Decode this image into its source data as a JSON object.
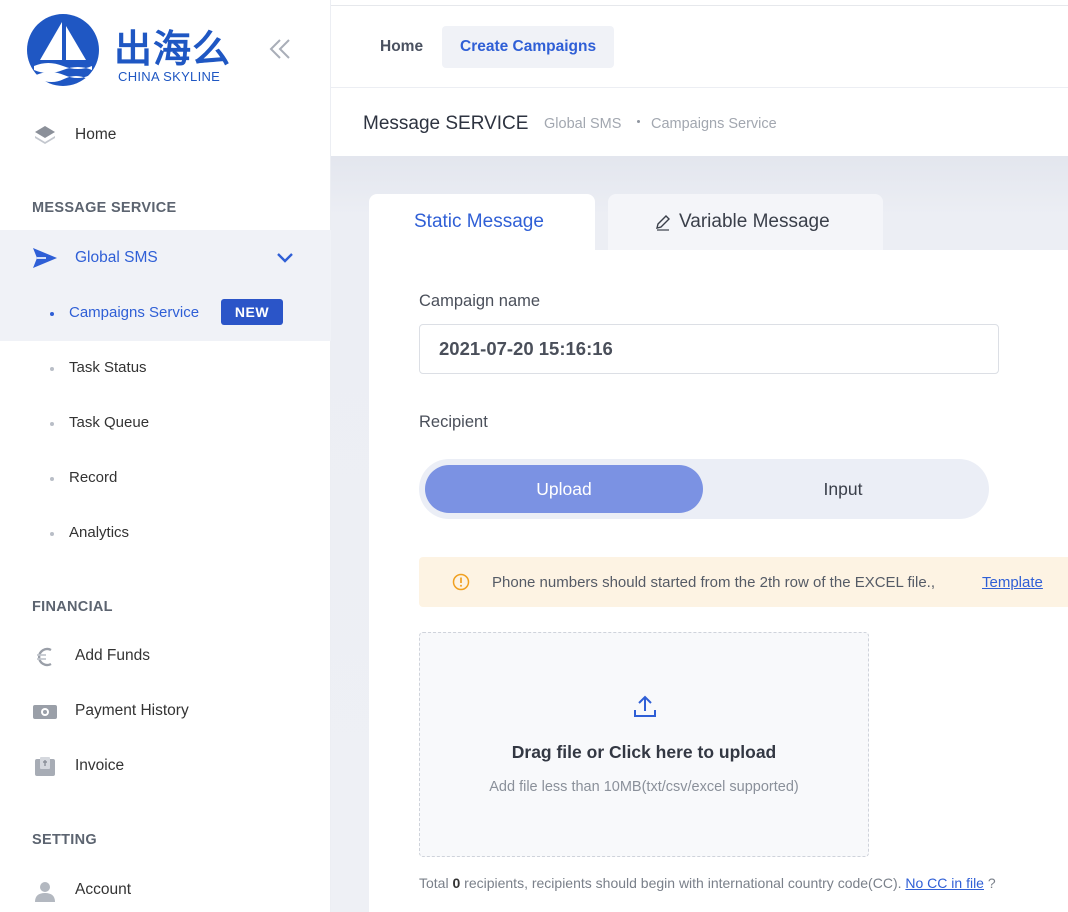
{
  "brand": {
    "name_cn": "出海么",
    "name_en": "CHINA SKYLINE",
    "primary_color": "#2f5fd6"
  },
  "sidebar": {
    "home_label": "Home",
    "sections": {
      "message_service": "MESSAGE SERVICE",
      "financial": "FINANCIAL",
      "setting": "SETTING"
    },
    "global_sms": {
      "label": "Global SMS",
      "expanded": true,
      "items": [
        {
          "label": "Campaigns Service",
          "badge": "NEW",
          "active": true
        },
        {
          "label": "Task Status"
        },
        {
          "label": "Task Queue"
        },
        {
          "label": "Record"
        },
        {
          "label": "Analytics"
        }
      ]
    },
    "financial_items": [
      {
        "label": "Add Funds",
        "icon": "euro-icon"
      },
      {
        "label": "Payment History",
        "icon": "money-icon"
      },
      {
        "label": "Invoice",
        "icon": "invoice-icon"
      }
    ],
    "setting_items": [
      {
        "label": "Account",
        "icon": "user-icon"
      }
    ]
  },
  "topbar": {
    "tabs": [
      {
        "label": "Home",
        "active": false
      },
      {
        "label": "Create Campaigns",
        "active": true
      }
    ]
  },
  "breadcrumb": {
    "title": "Message SERVICE",
    "path": [
      "Global SMS",
      "Campaigns Service"
    ]
  },
  "message_tabs": [
    {
      "label": "Static Message",
      "active": true
    },
    {
      "label": "Variable Message",
      "icon": "pen-icon",
      "active": false
    }
  ],
  "form": {
    "campaign_name_label": "Campaign name",
    "campaign_name_value": "2021-07-20 15:16:16",
    "recipient_label": "Recipient",
    "recipient_modes": [
      {
        "label": "Upload",
        "selected": true
      },
      {
        "label": "Input",
        "selected": false
      }
    ],
    "notice": {
      "text": "Phone numbers should started from the 2th row of the EXCEL file.,",
      "link": "Template",
      "color": "#fdf3e3"
    },
    "dropzone": {
      "title": "Drag file or Click here to upload",
      "subtitle": "Add file less than 10MB(txt/csv/excel supported)"
    },
    "footer": {
      "prefix": "Total",
      "count": "0",
      "middle": "recipients, recipients should begin with international country code(CC).",
      "link": "No CC in file",
      "suffix": "?"
    }
  }
}
